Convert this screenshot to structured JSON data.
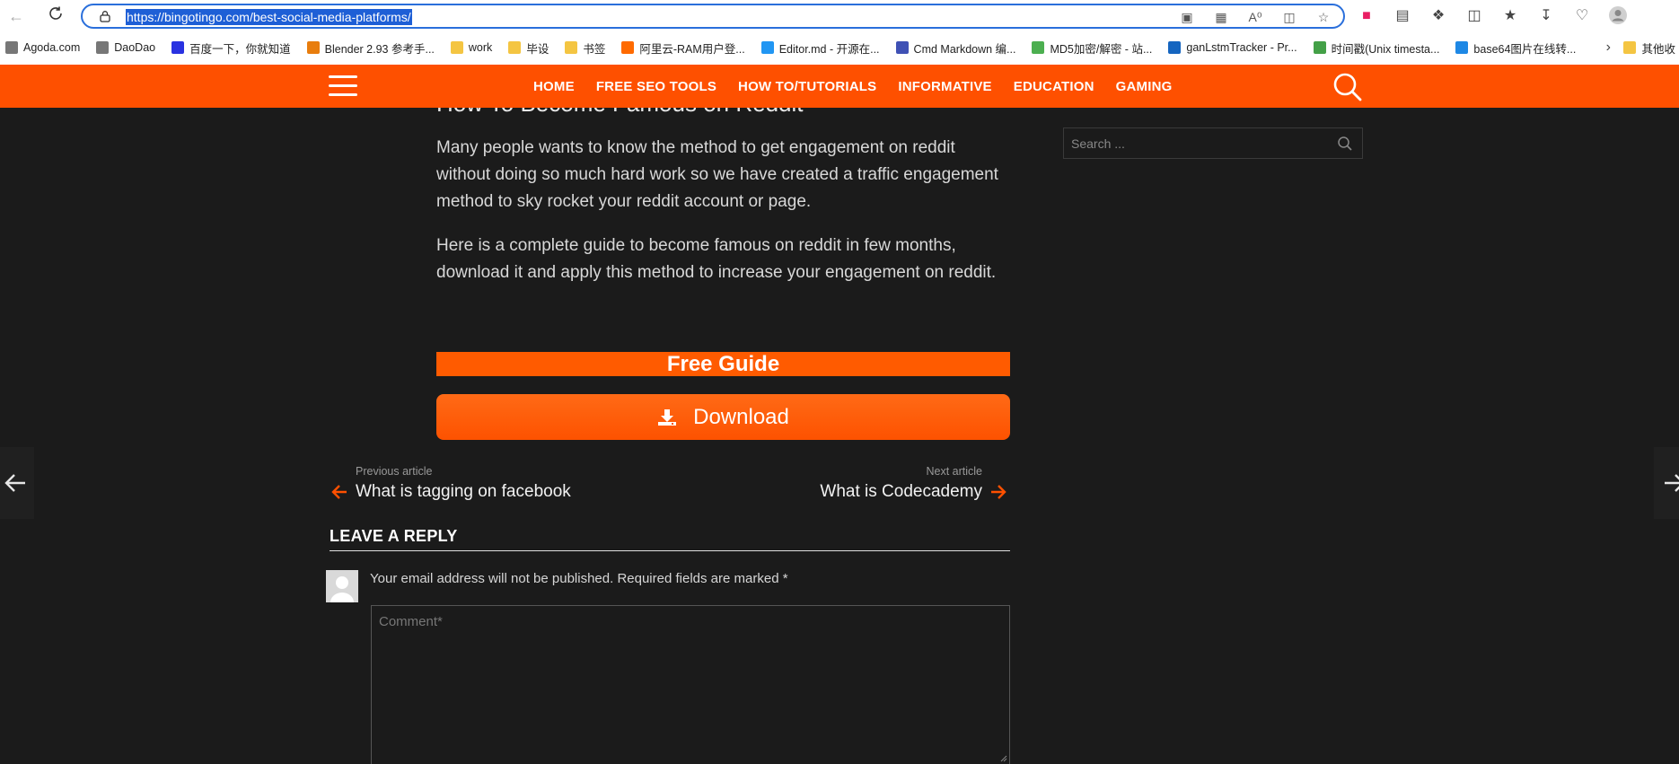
{
  "browser": {
    "url": "https://bingotingo.com/best-social-media-platforms/",
    "bookmarks": [
      {
        "label": "Agoda.com",
        "icon": "page-icon",
        "color": "#777777"
      },
      {
        "label": "DaoDao",
        "icon": "page-icon",
        "color": "#777777"
      },
      {
        "label": "百度一下，你就知道",
        "icon": "baidu-icon",
        "color": "#2932e1"
      },
      {
        "label": "Blender 2.93 参考手...",
        "icon": "blender-icon",
        "color": "#e87d0d"
      },
      {
        "label": "work",
        "icon": "folder-icon",
        "color": "#f4c542"
      },
      {
        "label": "毕设",
        "icon": "folder-icon",
        "color": "#f4c542"
      },
      {
        "label": "书签",
        "icon": "folder-icon",
        "color": "#f4c542"
      },
      {
        "label": "阿里云-RAM用户登...",
        "icon": "aliyun-icon",
        "color": "#ff6a00"
      },
      {
        "label": "Editor.md - 开源在...",
        "icon": "editormd-icon",
        "color": "#2196f3"
      },
      {
        "label": "Cmd Markdown 编...",
        "icon": "cmd-icon",
        "color": "#3f51b5"
      },
      {
        "label": "MD5加密/解密 - 站...",
        "icon": "md5-icon",
        "color": "#4caf50"
      },
      {
        "label": "ganLstmTracker - Pr...",
        "icon": "on-icon",
        "color": "#1565c0"
      },
      {
        "label": "时间戳(Unix timesta...",
        "icon": "timestamp-icon",
        "color": "#43a047"
      },
      {
        "label": "base64图片在线转...",
        "icon": "base64-icon",
        "color": "#1e88e5"
      }
    ],
    "other_bookmarks": "其他收"
  },
  "site_nav": {
    "links": [
      "HOME",
      "FREE SEO TOOLS",
      "HOW TO/TUTORIALS",
      "INFORMATIVE",
      "EDUCATION",
      "GAMING"
    ]
  },
  "article": {
    "partial_heading": "How To Become Famous on Reddit",
    "paragraphs": [
      "Many people wants to know the method to get engagement on reddit without doing so much hard work so we have created a traffic engagement method to sky rocket your reddit account or page.",
      "Here is a complete guide to become famous on reddit in few months, download it and apply this method to increase your engagement on reddit."
    ],
    "guide_banner": "Free Guide",
    "download_label": "Download"
  },
  "sidebar": {
    "search_placeholder": "Search ..."
  },
  "post_nav": {
    "previous_label": "Previous article",
    "previous_title": "What is tagging on facebook",
    "next_label": "Next article",
    "next_title": "What is Codecademy"
  },
  "reply": {
    "heading": "LEAVE A REPLY",
    "notice": "Your email address will not be published. Required fields are marked *",
    "comment_placeholder": "Comment*"
  },
  "colors": {
    "accent": "#fe5000",
    "page_bg": "#1b1b1b",
    "url_highlight": "#1e5fd6"
  }
}
